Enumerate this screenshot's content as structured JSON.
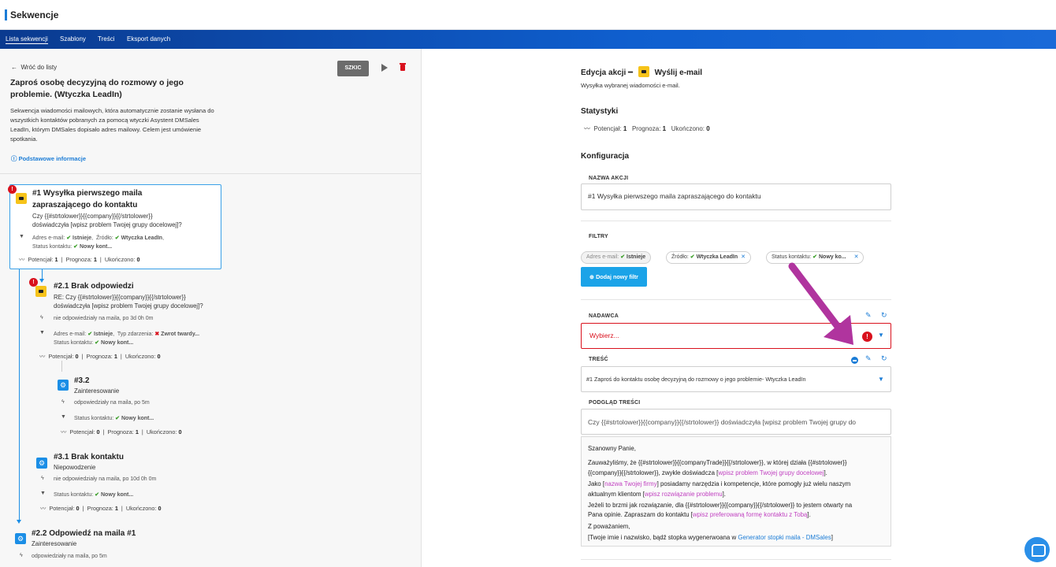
{
  "app": {
    "title": "Sekwencje"
  },
  "nav": {
    "tabs": [
      "Lista sekwencji",
      "Szablony",
      "Treści",
      "Eksport danych"
    ]
  },
  "left": {
    "back": "Wróć do listy",
    "status_badge": "SZKIC",
    "sequence_title": "Zaproś osobę decyzyjną do rozmowy o jego problemie. (Wtyczka LeadIn)",
    "sequence_description": "Sekwencja wiadomości mailowych, która automatycznie zostanie wysłana do wszystkich kontaktów pobranych za pomocą wtyczki Asystent DMSales LeadIn, którym DMSales dopisało adres mailowy. Celem jest umówienie spotkania.",
    "basic_info": "Podstawowe informacje",
    "node1": {
      "title": "#1 Wysyłka pierwszego maila zapraszającego do kontaktu",
      "line1": "Czy {{#strtolower}}{{company}}{{/strtolower}}",
      "line2": "doświadczyła [wpisz problem Twojej grupy docelowej]?",
      "f_email_k": "Adres e-mail:",
      "f_email_v": "Istnieje",
      "f_source_k": "Źródło:",
      "f_source_v": "Wtyczka LeadIn",
      "f_status_k": "Status kontaktu:",
      "f_status_v": "Nowy kont...",
      "stats": {
        "potencjal_k": "Potencjał:",
        "potencjal_v": "1",
        "prognoza_k": "Prognoza:",
        "prognoza_v": "1",
        "ukonczono_k": "Ukończono:",
        "ukonczono_v": "0"
      }
    },
    "node21": {
      "title": "#2.1 Brak odpowiedzi",
      "line1": "RE: Czy {{#strtolower}}{{company}}{{/strtolower}}",
      "line2": "doświadczyła [wpisz problem Twojej grupy docelowej]?",
      "cond": "nie odpowiedziały na maila, po 3d 0h 0m",
      "f_email_k": "Adres e-mail:",
      "f_email_v": "Istnieje",
      "f_event_k": "Typ zdarzenia:",
      "f_event_v": "Zwrot twardy...",
      "f_status_k": "Status kontaktu:",
      "f_status_v": "Nowy kont...",
      "stats": {
        "potencjal_k": "Potencjał:",
        "potencjal_v": "0",
        "prognoza_k": "Prognoza:",
        "prognoza_v": "1",
        "ukonczono_k": "Ukończono:",
        "ukonczono_v": "0"
      }
    },
    "node32": {
      "title": "#3.2",
      "sub": "Zainteresowanie",
      "cond": "odpowiedziały na maila, po 5m",
      "f_status_k": "Status kontaktu:",
      "f_status_v": "Nowy kont...",
      "stats": {
        "potencjal_k": "Potencjał:",
        "potencjal_v": "0",
        "prognoza_k": "Prognoza:",
        "prognoza_v": "1",
        "ukonczono_k": "Ukończono:",
        "ukonczono_v": "0"
      }
    },
    "node31": {
      "title": "#3.1 Brak kontaktu",
      "sub": "Niepowodzenie",
      "cond": "nie odpowiedziały na maila, po 10d 0h 0m",
      "f_status_k": "Status kontaktu:",
      "f_status_v": "Nowy kont...",
      "stats": {
        "potencjal_k": "Potencjał:",
        "potencjal_v": "0",
        "prognoza_k": "Prognoza:",
        "prognoza_v": "1",
        "ukonczono_k": "Ukończono:",
        "ukonczono_v": "0"
      }
    },
    "node22": {
      "title": "#2.2 Odpowiedź na maila #1",
      "sub": "Zainteresowanie",
      "cond": "odpowiedziały na maila, po 5m"
    }
  },
  "right": {
    "edit_prefix": "Edycja akcji",
    "edit_action": "Wyślij e-mail",
    "edit_sub": "Wysyłka wybranej wiadomości e-mail.",
    "stats_title": "Statystyki",
    "stats": {
      "potencjal_k": "Potencjał:",
      "potencjal_v": "1",
      "prognoza_k": "Prognoza:",
      "prognoza_v": "1",
      "ukonczono_k": "Ukończono:",
      "ukonczono_v": "0"
    },
    "config_title": "Konfiguracja",
    "name_label": "NAZWA AKCJI",
    "name_value": "#1 Wysyłka pierwszego maila zapraszającego do kontaktu",
    "filters_label": "FILTRY",
    "chip1_k": "Adres e-mail:",
    "chip1_v": "Istnieje",
    "chip2_k": "Źródło:",
    "chip2_v": "Wtyczka LeadIn",
    "chip3_k": "Status kontaktu:",
    "chip3_v": "Nowy ko...",
    "add_filter": "Dodaj nowy filtr",
    "sender_label": "NADAWCA",
    "sender_placeholder": "Wybierz...",
    "content_label": "TREŚĆ",
    "content_value": "#1 Zaproś do kontaktu osobę decyzyjną do rozmowy o jego problemie- Wtyczka LeadIn",
    "preview_label": "PODGLĄD TREŚCI",
    "preview_subject": "Czy {{#strtolower}}{{company}}{{/strtolower}} doświadczyła [wpisz problem Twojej grupy do",
    "body": {
      "greeting": "Szanowny Panie,",
      "p1a": "Zauważyliśmy, że {{#strtolower}}{{companyTrade}}{{/strtolower}}, w której działa {{#strtolower}}",
      "p1b": "{{company}}{{/strtolower}}, zwykle doświadcza [",
      "p1link": "wpisz problem Twojej grupy docelowej",
      "p1end": "].",
      "p2a": "Jako [",
      "p2link": "nazwa Twojej firmy",
      "p2b": "] posiadamy narzędzia i kompetencje, które pomogły już wielu naszym",
      "p2c": "aktualnym klientom [",
      "p2link2": "wpisz rozwiązanie problemu",
      "p2end": "].",
      "p3a": "Jeżeli to brzmi jak rozwiązanie, dla {{#strtolower}}{{company}}{{/strtolower}} to jestem otwarty na",
      "p3b": "Pana opinie. Zapraszam do kontaktu [",
      "p3link": "wpisz preferowaną formę kontaktu z Tobą",
      "p3end": "].",
      "regards": "Z poważaniem,",
      "sig_a": "[Twoje imie i nazwisko, bądź stopka wygenerwoana w ",
      "sig_link": "Generator stopki maila - DMSales",
      "sig_end": "]"
    }
  }
}
